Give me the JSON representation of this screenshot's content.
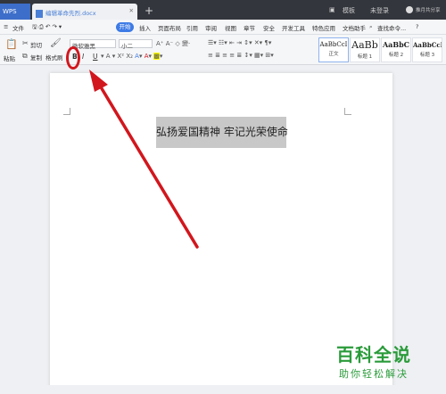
{
  "titlebar": {
    "app": "WPS",
    "doc_tab": "编辑革命先烈.docx",
    "plus": "+",
    "template": "模板",
    "login": "未登录",
    "user": "推月共分享"
  },
  "menu": {
    "items": [
      "文件",
      "开始",
      "插入",
      "页面布局",
      "引用",
      "审阅",
      "视图",
      "章节",
      "安全",
      "开发工具",
      "特色应用",
      "文档助手"
    ],
    "search": "查找命令...",
    "help": "?"
  },
  "ribbon": {
    "paste": "粘贴",
    "cut": "剪切",
    "copy": "复制",
    "format_painter": "格式刷",
    "font_name": "微软雅黑",
    "font_size": "小二",
    "bold": "B",
    "italic": "I",
    "underline": "U",
    "styles": [
      {
        "sample": "AaBbCcI",
        "label": "正文"
      },
      {
        "sample": "AaBb",
        "label": "标题 1"
      },
      {
        "sample": "AaBbC",
        "label": "标题 2"
      },
      {
        "sample": "AaBbCcI",
        "label": "标题 3"
      }
    ]
  },
  "document": {
    "selected_text": "弘扬爱国精神  牢记光荣使命"
  },
  "watermark": {
    "title": "百科全说",
    "subtitle": "助你轻松解决"
  },
  "colors": {
    "accent": "#3d7be6",
    "annotation": "#d2161d",
    "watermark": "#2a9b3a"
  }
}
